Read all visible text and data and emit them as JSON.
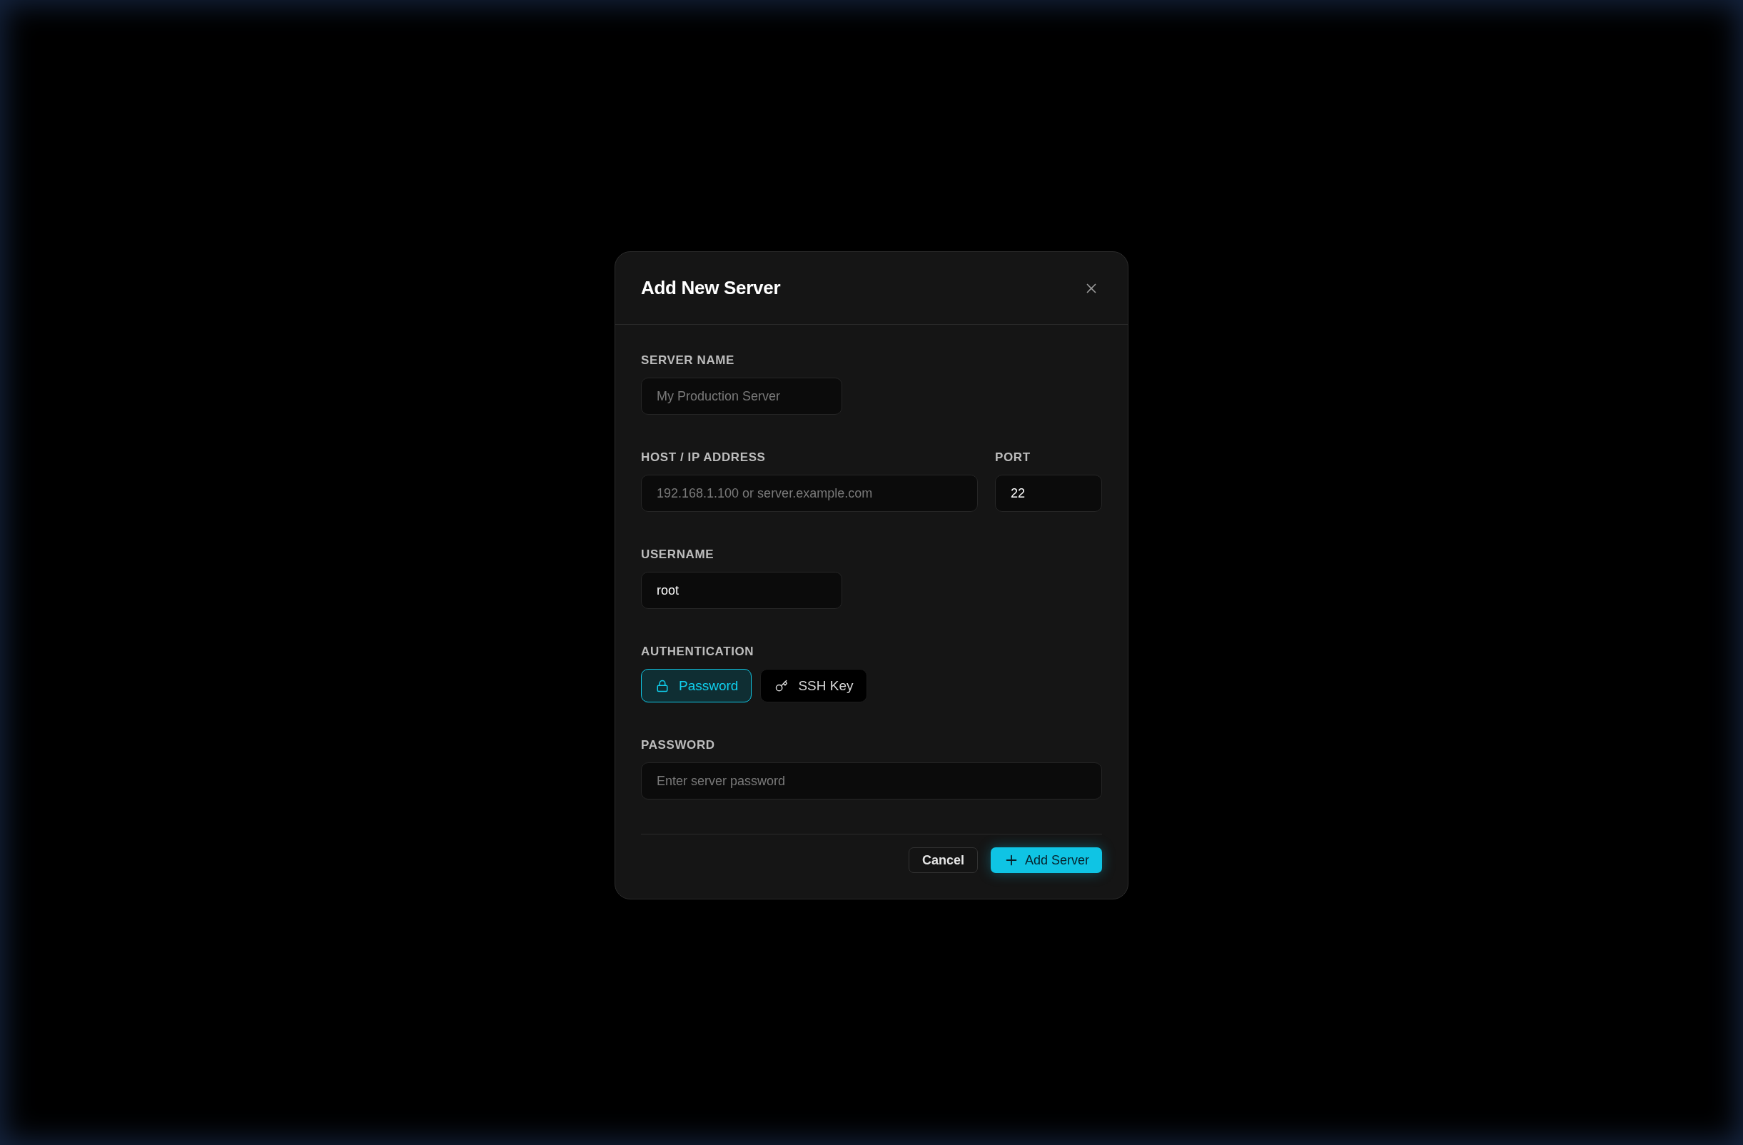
{
  "dialog": {
    "title": "Add New Server",
    "rows": [
      {
        "kind": "fields",
        "fields": [
          {
            "label": "SERVER NAME",
            "placeholder": "My Production Server"
          }
        ]
      },
      {
        "kind": "fields",
        "fields": [
          {
            "label": "HOST / IP ADDRESS",
            "placeholder": "192.168.1.100 or server.example.com"
          },
          {
            "label": "PORT",
            "value": "22"
          }
        ]
      },
      {
        "kind": "fields",
        "fields": [
          {
            "label": "USERNAME",
            "value": "root"
          }
        ]
      },
      {
        "kind": "auth",
        "label": "AUTHENTICATION",
        "options": [
          {
            "label": "Password",
            "selected": true
          },
          {
            "label": "SSH Key",
            "selected": false
          }
        ]
      },
      {
        "kind": "password",
        "fields": [
          {
            "label": "PASSWORD",
            "placeholder": "Enter server password"
          }
        ]
      }
    ],
    "buttons": [
      {
        "label": "Cancel",
        "kind": "secondary"
      },
      {
        "label": "Add Server",
        "kind": "primary"
      }
    ]
  }
}
